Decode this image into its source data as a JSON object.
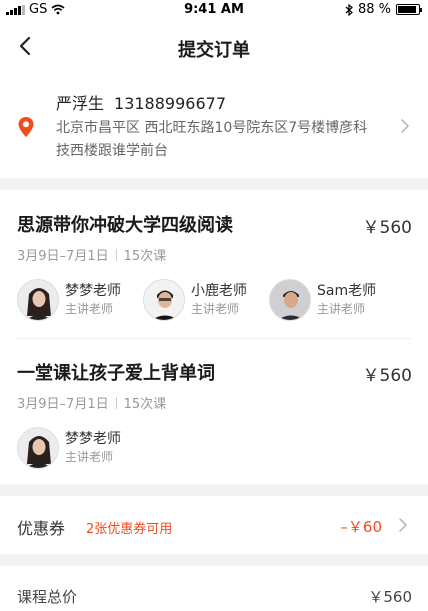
{
  "status_bar": {
    "carrier": "GS",
    "time": "9:41 AM",
    "battery": "88 %",
    "battery_level": 0.88
  },
  "nav": {
    "title": "提交订单"
  },
  "address": {
    "name": "严浮生",
    "phone": "13188996677",
    "detail": "北京市昌平区 西北旺东路10号院东区7号楼博彦科技西楼跟谁学前台"
  },
  "courses": [
    {
      "name": "思源带你冲破大学四级阅读",
      "price": "￥560",
      "dates": "3月9日–7月1日",
      "lessons": "15次课",
      "teachers": [
        {
          "name": "梦梦老师",
          "role": "主讲老师"
        },
        {
          "name": "小鹿老师",
          "role": "主讲老师"
        },
        {
          "name": "Sam老师",
          "role": "主讲老师"
        }
      ]
    },
    {
      "name": "一堂课让孩子爱上背单词",
      "price": "￥560",
      "dates": "3月9日–7月1日",
      "lessons": "15次课",
      "teachers": [
        {
          "name": "梦梦老师",
          "role": "主讲老师"
        }
      ]
    }
  ],
  "coupon": {
    "label": "优惠券",
    "hint": "2张优惠券可用",
    "amount": "–￥60"
  },
  "total": {
    "label": "课程总价",
    "value": "￥560"
  },
  "colors": {
    "accent": "#f04e1f",
    "divider": "#f3f3f3"
  }
}
